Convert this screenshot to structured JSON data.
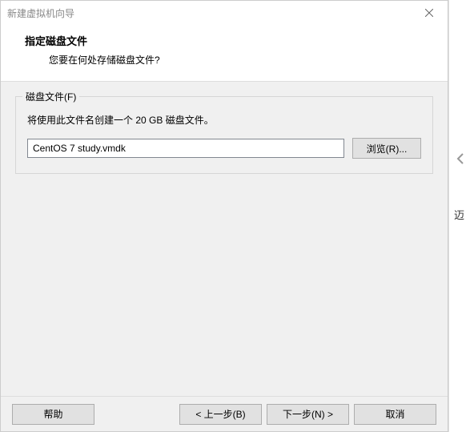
{
  "titlebar": {
    "title": "新建虚拟机向导"
  },
  "header": {
    "title": "指定磁盘文件",
    "subtitle": "您要在何处存储磁盘文件?"
  },
  "fieldset": {
    "legend": "磁盘文件(F)",
    "description": "将使用此文件名创建一个 20 GB 磁盘文件。",
    "filename": "CentOS 7 study.vmdk",
    "browse_label": "浏览(R)..."
  },
  "footer": {
    "help_label": "帮助",
    "back_label": "< 上一步(B)",
    "next_label": "下一步(N) >",
    "cancel_label": "取消"
  },
  "side": {
    "text": "迈"
  }
}
